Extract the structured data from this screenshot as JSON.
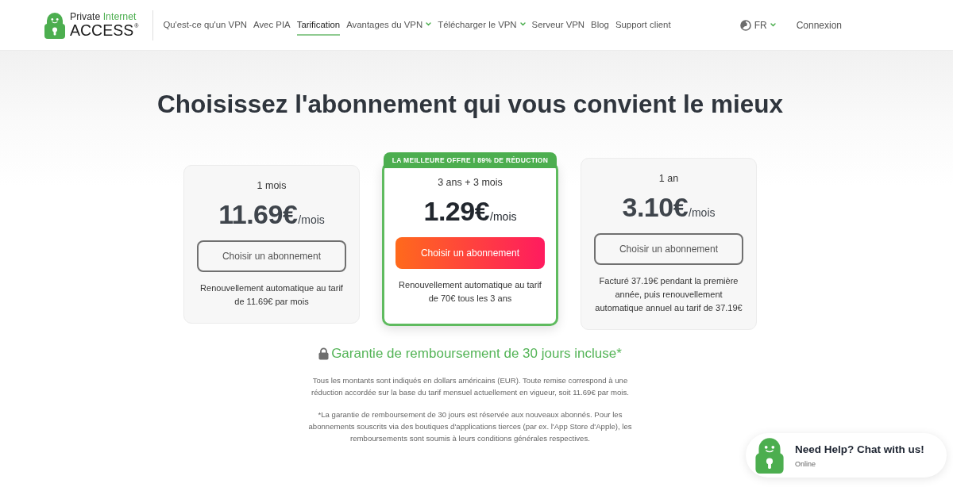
{
  "header": {
    "logo": {
      "words": [
        {
          "text": "Private",
          "accent": false
        },
        {
          "text": "Internet",
          "accent": true
        }
      ],
      "name": "ACCESS",
      "registered_mark": "®"
    },
    "nav": [
      {
        "label": "Qu'est-ce qu'un VPN",
        "selected": false,
        "has_menu": false
      },
      {
        "label": "Avec PIA",
        "selected": false,
        "has_menu": false
      },
      {
        "label": "Tarification",
        "selected": true,
        "has_menu": false
      },
      {
        "label": "Avantages du VPN",
        "selected": false,
        "has_menu": true
      },
      {
        "label": "Télécharger le VPN",
        "selected": false,
        "has_menu": true
      },
      {
        "label": "Serveur VPN",
        "selected": false,
        "has_menu": false
      },
      {
        "label": "Blog",
        "selected": false,
        "has_menu": false
      },
      {
        "label": "Support client",
        "selected": false,
        "has_menu": false
      }
    ],
    "language": {
      "label": "FR",
      "has_menu": true
    },
    "login": "Connexion"
  },
  "title": "Choisissez l'abonnement qui vous convient le mieux",
  "plans": [
    {
      "period": "1 mois",
      "price": "11.69€",
      "unit": "/mois",
      "button": "Choisir un abonnement",
      "note": "Renouvellement automatique au tarif de 11.69€ par mois",
      "featured": false
    },
    {
      "badge": "LA MEILLEURE OFFRE ! 89% DE RÉDUCTION",
      "period": "3 ans + 3 mois",
      "price": "1.29€",
      "unit": "/mois",
      "button": "Choisir un abonnement",
      "note": "Renouvellement automatique au tarif de 70€ tous les 3 ans",
      "featured": true
    },
    {
      "period": "1 an",
      "price": "3.10€",
      "unit": "/mois",
      "button": "Choisir un abonnement",
      "note": "Facturé 37.19€ pendant la première année, puis renouvellement automatique annuel au tarif de 37.19€",
      "featured": false
    }
  ],
  "guarantee": "Garantie de remboursement de 30 jours incluse*",
  "notes": [
    "Tous les montants sont indiqués en dollars américains (EUR). Toute remise correspond à une réduction accordée sur la base du tarif mensuel actuellement en vigueur, soit 11.69€ par mois.",
    "*La garantie de remboursement de 30 jours est réservée aux nouveaux abonnés. Pour les abonnements souscrits via des boutiques d'applications tierces (par ex. l'App Store d'Apple), les remboursements sont soumis à leurs conditions générales respectives."
  ],
  "chat": {
    "title": "Need Help? Chat with us!",
    "status": "Online"
  }
}
